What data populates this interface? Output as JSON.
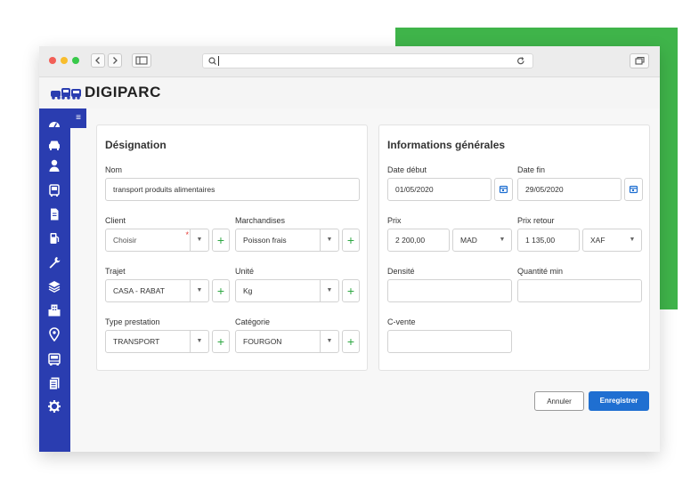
{
  "browser": {
    "url_value": ""
  },
  "app": {
    "brand": "DIGIPARC"
  },
  "sidebar": {
    "toggle_glyph": "≡",
    "items": [
      {
        "icon": "dashboard-icon"
      },
      {
        "icon": "car-icon"
      },
      {
        "icon": "user-icon"
      },
      {
        "icon": "bus-icon"
      },
      {
        "icon": "document-icon"
      },
      {
        "icon": "fuel-pump-icon"
      },
      {
        "icon": "wrench-icon"
      },
      {
        "icon": "layers-icon"
      },
      {
        "icon": "building-icon"
      },
      {
        "icon": "map-pin-icon"
      },
      {
        "icon": "truck-icon"
      },
      {
        "icon": "list-icon"
      },
      {
        "icon": "gear-icon"
      }
    ]
  },
  "designation": {
    "title": "Désignation",
    "nom_label": "Nom",
    "nom_value": "transport produits alimentaires",
    "client_label": "Client",
    "client_value": "Choisir",
    "marchandises_label": "Marchandises",
    "marchandises_value": "Poisson frais",
    "trajet_label": "Trajet",
    "trajet_value": "CASA - RABAT",
    "unite_label": "Unité",
    "unite_value": "Kg",
    "type_label": "Type prestation",
    "type_value": "TRANSPORT",
    "categorie_label": "Catégorie",
    "categorie_value": "FOURGON",
    "required_mark": "*",
    "add_glyph": "+",
    "dropdown_glyph": "▼"
  },
  "infos": {
    "title": "Informations générales",
    "date_debut_label": "Date début",
    "date_debut_value": "01/05/2020",
    "date_fin_label": "Date fin",
    "date_fin_value": "29/05/2020",
    "prix_label": "Prix",
    "prix_value": "2 200,00",
    "prix_currency": "MAD",
    "prix_retour_label": "Prix retour",
    "prix_retour_value": "1 135,00",
    "prix_retour_currency": "XAF",
    "densite_label": "Densité",
    "densite_value": "",
    "quantite_label": "Quantité min",
    "quantite_value": "",
    "cvente_label": "C-vente",
    "cvente_value": ""
  },
  "actions": {
    "cancel_label": "Annuler",
    "save_label": "Enregistrer"
  },
  "colors": {
    "sidebar": "#2a3db0",
    "primary": "#1f6fd1",
    "accent_green": "#3fb44a",
    "plus_green": "#2ea843"
  }
}
